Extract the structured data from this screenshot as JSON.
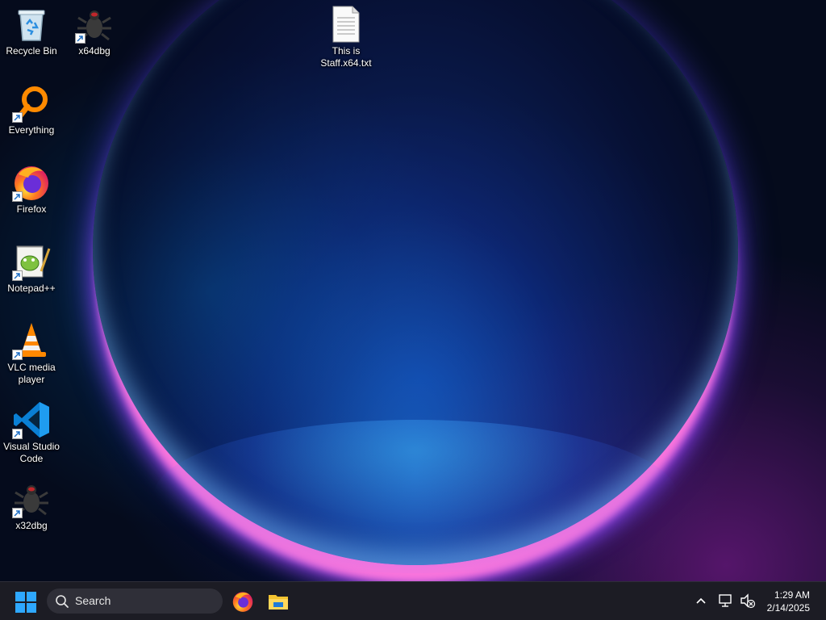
{
  "desktop": {
    "icons": [
      {
        "label": "Recycle Bin",
        "icon": "recycle-bin-icon",
        "shortcut": false
      },
      {
        "label": "x64dbg",
        "icon": "bug-icon",
        "shortcut": true
      },
      {
        "label": "This is Staff.x64.txt",
        "icon": "text-file-icon",
        "shortcut": false
      },
      {
        "label": "Everything",
        "icon": "magnifier-icon",
        "shortcut": true
      },
      {
        "label": "Firefox",
        "icon": "firefox-icon",
        "shortcut": true
      },
      {
        "label": "Notepad++",
        "icon": "notepadpp-icon",
        "shortcut": true
      },
      {
        "label": "VLC media player",
        "icon": "vlc-cone-icon",
        "shortcut": true
      },
      {
        "label": "Visual Studio Code",
        "icon": "vscode-icon",
        "shortcut": true
      },
      {
        "label": "x32dbg",
        "icon": "bug-icon",
        "shortcut": true
      }
    ]
  },
  "taskbar": {
    "search": {
      "placeholder": "Search"
    },
    "pinned": [
      {
        "name": "Firefox",
        "icon": "firefox-icon"
      },
      {
        "name": "File Explorer",
        "icon": "folder-icon"
      }
    ],
    "clock": {
      "time": "1:29 AM",
      "date": "2/14/2025"
    }
  },
  "colors": {
    "taskbar_bg": "#1c1c24",
    "search_bg": "#2f2f38",
    "start_blue": "#0a84ff"
  }
}
